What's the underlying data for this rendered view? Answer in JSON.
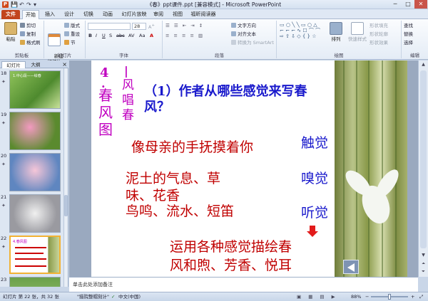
{
  "window": {
    "title": "《春》ppt课件.ppt [兼容模式] - Microsoft PowerPoint",
    "minimize": "─",
    "maximize": "□",
    "close": "✕",
    "app_icon": "P"
  },
  "quick_access": {
    "save": "💾",
    "undo": "↶",
    "redo": "↷",
    "more": "▾"
  },
  "tabs": [
    {
      "label": "文件"
    },
    {
      "label": "开始"
    },
    {
      "label": "插入"
    },
    {
      "label": "设计"
    },
    {
      "label": "切换"
    },
    {
      "label": "动画"
    },
    {
      "label": "幻灯片放映"
    },
    {
      "label": "审阅"
    },
    {
      "label": "视图"
    },
    {
      "label": "福昕阅读器"
    }
  ],
  "ribbon": {
    "clipboard": {
      "label": "剪贴板",
      "paste": "粘贴",
      "cut": "剪切",
      "copy": "复制",
      "format_painter": "格式刷"
    },
    "slides": {
      "label": "幻灯片",
      "new_slide": "新建\n幻灯片",
      "layout": "版式",
      "reset": "重设",
      "section": "节"
    },
    "font": {
      "label": "字体",
      "font_size": "28",
      "bold": "B",
      "italic": "I",
      "underline": "U",
      "strike": "S",
      "abc": "abc",
      "spacing": "AV",
      "case": "Aa",
      "color": "A"
    },
    "paragraph": {
      "label": "段落",
      "text_direction": "文字方向",
      "align_text": "对齐文本",
      "smartart": "转换为 SmartArt"
    },
    "drawing": {
      "label": "绘图",
      "arrange": "排列",
      "quick_styles": "快速样式",
      "shape_fill": "形状填充",
      "shape_outline": "形状轮廓",
      "shape_effects": "形状效果"
    },
    "editing": {
      "label": "编辑",
      "find": "查找",
      "replace": "替换",
      "select": "选择"
    }
  },
  "left_panel": {
    "tab_slides": "幻灯片",
    "tab_outline": "大纲",
    "close": "×",
    "thumbs": [
      {
        "num": "18",
        "star": "✦",
        "caption": "1.中心段——绘春"
      },
      {
        "num": "19",
        "star": "✦"
      },
      {
        "num": "20",
        "star": "✦"
      },
      {
        "num": "21",
        "star": "✦"
      },
      {
        "num": "22",
        "star": "✦",
        "caption": "4.春风图"
      },
      {
        "num": "23",
        "star": "✦"
      }
    ]
  },
  "slide": {
    "number_label": "4",
    "dot": ".",
    "title_vertical": [
      "春",
      "风",
      "图"
    ],
    "subtitle_vertical": [
      "风",
      "唱",
      "春"
    ],
    "bar": "|",
    "question_line1": "（1）作者从哪些感觉来写春",
    "question_line2": "风？",
    "row1_text": "像母亲的手抚摸着你",
    "row1_sense": "触觉",
    "row2_text_line1": "泥土的气息、草",
    "row2_text_line2": "味、花香",
    "row2_sense": "嗅觉",
    "row3_text": "鸟鸣、流水、短笛",
    "row3_sense": "听觉",
    "summary_line1": "运用各种感觉描绘春",
    "summary_line2": "风和煦、芳香、悦耳",
    "colors": {
      "title": "#c000c0",
      "question": "#1a1acc",
      "body": "#c00000",
      "sense": "#1a1acc"
    }
  },
  "notes_placeholder": "单击此处添加备注",
  "status": {
    "slide_info": "幻灯片 第 22 张，共 32 张",
    "theme": "\"猎院整帽刻计\"",
    "lang_icon": "✓",
    "language": "中文(中国)",
    "zoom": "88%",
    "zoom_minus": "−",
    "zoom_plus": "+"
  }
}
